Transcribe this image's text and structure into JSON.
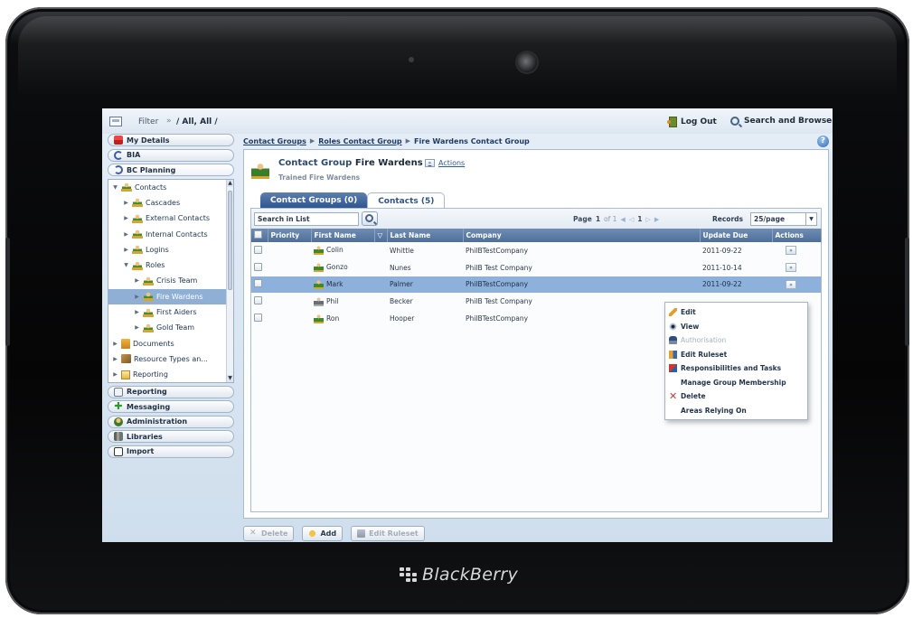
{
  "device": {
    "brand": "BlackBerry"
  },
  "topbar": {
    "filter_label": "Filter",
    "filter_value": "/ All, All /",
    "logout_label": "Log Out",
    "search_browse_label": "Search and Browse"
  },
  "nav": {
    "pills_top": [
      {
        "label": "My Details",
        "icon": "book-icon"
      },
      {
        "label": "BIA",
        "icon": "bia-icon"
      },
      {
        "label": "BC Planning",
        "icon": "planning-icon"
      }
    ],
    "tree": [
      {
        "label": "Contacts",
        "level": 0,
        "arrow": "▼",
        "icon": "people"
      },
      {
        "label": "Cascades",
        "level": 1,
        "arrow": "▶",
        "icon": "people"
      },
      {
        "label": "External Contacts",
        "level": 1,
        "arrow": "▶",
        "icon": "people"
      },
      {
        "label": "Internal Contacts",
        "level": 1,
        "arrow": "▶",
        "icon": "people"
      },
      {
        "label": "Logins",
        "level": 1,
        "arrow": "▶",
        "icon": "people"
      },
      {
        "label": "Roles",
        "level": 1,
        "arrow": "▼",
        "icon": "people"
      },
      {
        "label": "Crisis Team",
        "level": 2,
        "arrow": "▶",
        "icon": "people"
      },
      {
        "label": "Fire Wardens",
        "level": 2,
        "arrow": "▶",
        "icon": "people",
        "selected": true
      },
      {
        "label": "First Aiders",
        "level": 2,
        "arrow": "▶",
        "icon": "people"
      },
      {
        "label": "Gold Team",
        "level": 2,
        "arrow": "▶",
        "icon": "people"
      },
      {
        "label": "Documents",
        "level": 0,
        "arrow": "▶",
        "icon": "doc"
      },
      {
        "label": "Resource Types an...",
        "level": 0,
        "arrow": "▶",
        "icon": "res"
      },
      {
        "label": "Reporting",
        "level": 0,
        "arrow": "▶",
        "icon": "rep"
      }
    ],
    "pills_bottom": [
      {
        "label": "Reporting",
        "icon": "report-icon"
      },
      {
        "label": "Messaging",
        "icon": "messaging-icon"
      },
      {
        "label": "Administration",
        "icon": "administration-icon"
      },
      {
        "label": "Libraries",
        "icon": "libraries-icon"
      },
      {
        "label": "Import",
        "icon": "import-icon"
      }
    ]
  },
  "breadcrumb": {
    "items": [
      "Contact Groups",
      "Roles Contact Group",
      "Fire Wardens Contact Group"
    ],
    "help": "?"
  },
  "group": {
    "title_prefix": "Contact Group",
    "title_name": "Fire Wardens",
    "subtitle": "Trained Fire Wardens",
    "actions_label": "Actions"
  },
  "tabs": [
    {
      "label": "Contact Groups (0)",
      "active": false
    },
    {
      "label": "Contacts (5)",
      "active": true
    }
  ],
  "list": {
    "search_placeholder": "Search in List",
    "page_label": "Page",
    "page_current": "1",
    "page_of": "of 1",
    "page_box": "1",
    "records_label": "Records",
    "records_value": "25/page",
    "columns": [
      "",
      "Priority",
      "First Name",
      "",
      "Last Name",
      "Company",
      "Update Due",
      "Actions"
    ],
    "rows": [
      {
        "first": "Colin",
        "last": "Whittle",
        "company": "PhilBTestCompany",
        "due": "2011-09-22",
        "icon": "green"
      },
      {
        "first": "Gonzo",
        "last": "Nunes",
        "company": "PhilB Test Company",
        "due": "2011-10-14",
        "icon": "green"
      },
      {
        "first": "Mark",
        "last": "Palmer",
        "company": "PhilBTestCompany",
        "due": "2011-09-22",
        "icon": "green",
        "selected": true
      },
      {
        "first": "Phil",
        "last": "Becker",
        "company": "PhilB Test Company",
        "due": "",
        "icon": "grey"
      },
      {
        "first": "Ron",
        "last": "Hooper",
        "company": "PhilBTestCompany",
        "due": "",
        "icon": "green"
      }
    ]
  },
  "context_menu": [
    {
      "label": "Edit",
      "icon": "pencil-icon",
      "enabled": true
    },
    {
      "label": "View",
      "icon": "eye-icon",
      "enabled": true
    },
    {
      "label": "Authorisation",
      "icon": "authorisation-icon",
      "enabled": false
    },
    {
      "label": "Edit Ruleset",
      "icon": "ruleset-icon",
      "enabled": true
    },
    {
      "label": "Responsibilities and Tasks",
      "icon": "tasks-icon",
      "enabled": true
    },
    {
      "label": "Manage Group Membership",
      "icon": "",
      "enabled": true
    },
    {
      "label": "Delete",
      "icon": "delete-icon",
      "enabled": true
    },
    {
      "label": "Areas Relying On",
      "icon": "",
      "enabled": true
    }
  ],
  "footer": {
    "delete_label": "Delete",
    "add_label": "Add",
    "edit_ruleset_label": "Edit Ruleset"
  }
}
